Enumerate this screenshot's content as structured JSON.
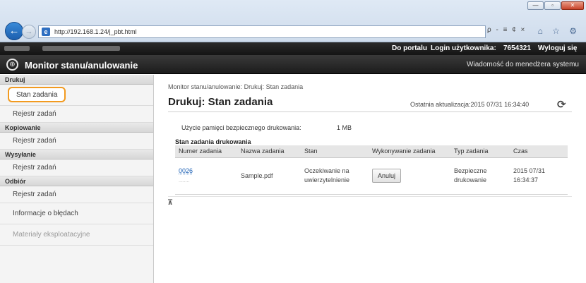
{
  "browser": {
    "url": "http://192.168.1.24/j_pbt.html",
    "address_tools": "ρ - ≡ ¢ ×",
    "tool_icons": "⌂ ☆ ⚙",
    "window_buttons": [
      "—",
      "▫",
      "✕"
    ]
  },
  "header": {
    "portal_link": "Do portalu",
    "login_label": "Login użytkownika:",
    "login_id": "7654321",
    "logout_link": "Wyloguj się",
    "app_title": "Monitor stanu/anulowanie",
    "admin_message_link": "Wiadomość do menedżera systemu"
  },
  "sidebar": {
    "sections": [
      {
        "title": "Drukuj",
        "items": [
          {
            "label": "Stan zadania",
            "active": true
          },
          {
            "label": "Rejestr zadań"
          }
        ]
      },
      {
        "title": "Kopiowanie",
        "items": [
          {
            "label": "Rejestr zadań"
          }
        ]
      },
      {
        "title": "Wysyłanie",
        "items": [
          {
            "label": "Rejestr zadań"
          }
        ]
      },
      {
        "title": "Odbiór",
        "items": [
          {
            "label": "Rejestr zadań"
          },
          {
            "label": "Informacje o błędach"
          },
          {
            "label": "Materiały eksploatacyjne"
          }
        ]
      }
    ]
  },
  "main": {
    "breadcrumb": "Monitor stanu/anulowanie: Drukuj: Stan zadania",
    "title": "Drukuj: Stan zadania",
    "last_update": "Ostatnia aktualizacja:2015 07/31 16:34:40",
    "memory_label": "Użycie pamięci bezpiecznego drukowania:",
    "memory_value": "1 MB",
    "table_caption": "Stan zadania drukowania",
    "columns": [
      "Numer zadania",
      "Nazwa zadania",
      "Stan",
      "Wykonywanie zadania",
      "Typ zadania",
      "Czas"
    ],
    "rows": [
      {
        "number": "0026",
        "number_sub": "........",
        "name": "Sample.pdf",
        "status": "Oczekiwanie na uwierzytelnienie",
        "action": "Anuluj",
        "type": "Bezpieczne drukowanie",
        "time": "2015 07/31 16:34:37"
      }
    ]
  },
  "colors": {
    "highlight": "#f29a1f",
    "link": "#1a5fb4",
    "header_bg": "#1c1c1c"
  }
}
